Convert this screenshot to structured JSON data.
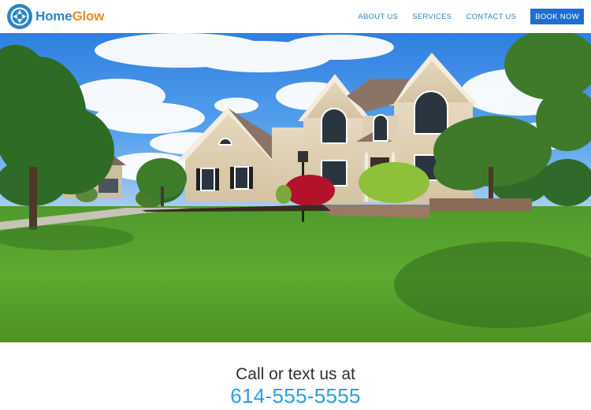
{
  "brand": {
    "name_part1": "Home",
    "name_part2": "Glow",
    "icon": "camera-aperture-logo",
    "colors": {
      "primary": "#2a86c8",
      "accent": "#f08a24"
    }
  },
  "nav": {
    "items": [
      {
        "label": "ABOUT US"
      },
      {
        "label": "SERVICES"
      },
      {
        "label": "CONTACT US"
      }
    ],
    "cta_label": "BOOK NOW",
    "cta_color": "#1f6fd1"
  },
  "hero": {
    "subject": "photo of a two-story beige house with a green lawn under a blue sky"
  },
  "contact": {
    "label": "Call or text us at",
    "phone": "614-555-5555",
    "phone_color": "#2a9fe0"
  }
}
